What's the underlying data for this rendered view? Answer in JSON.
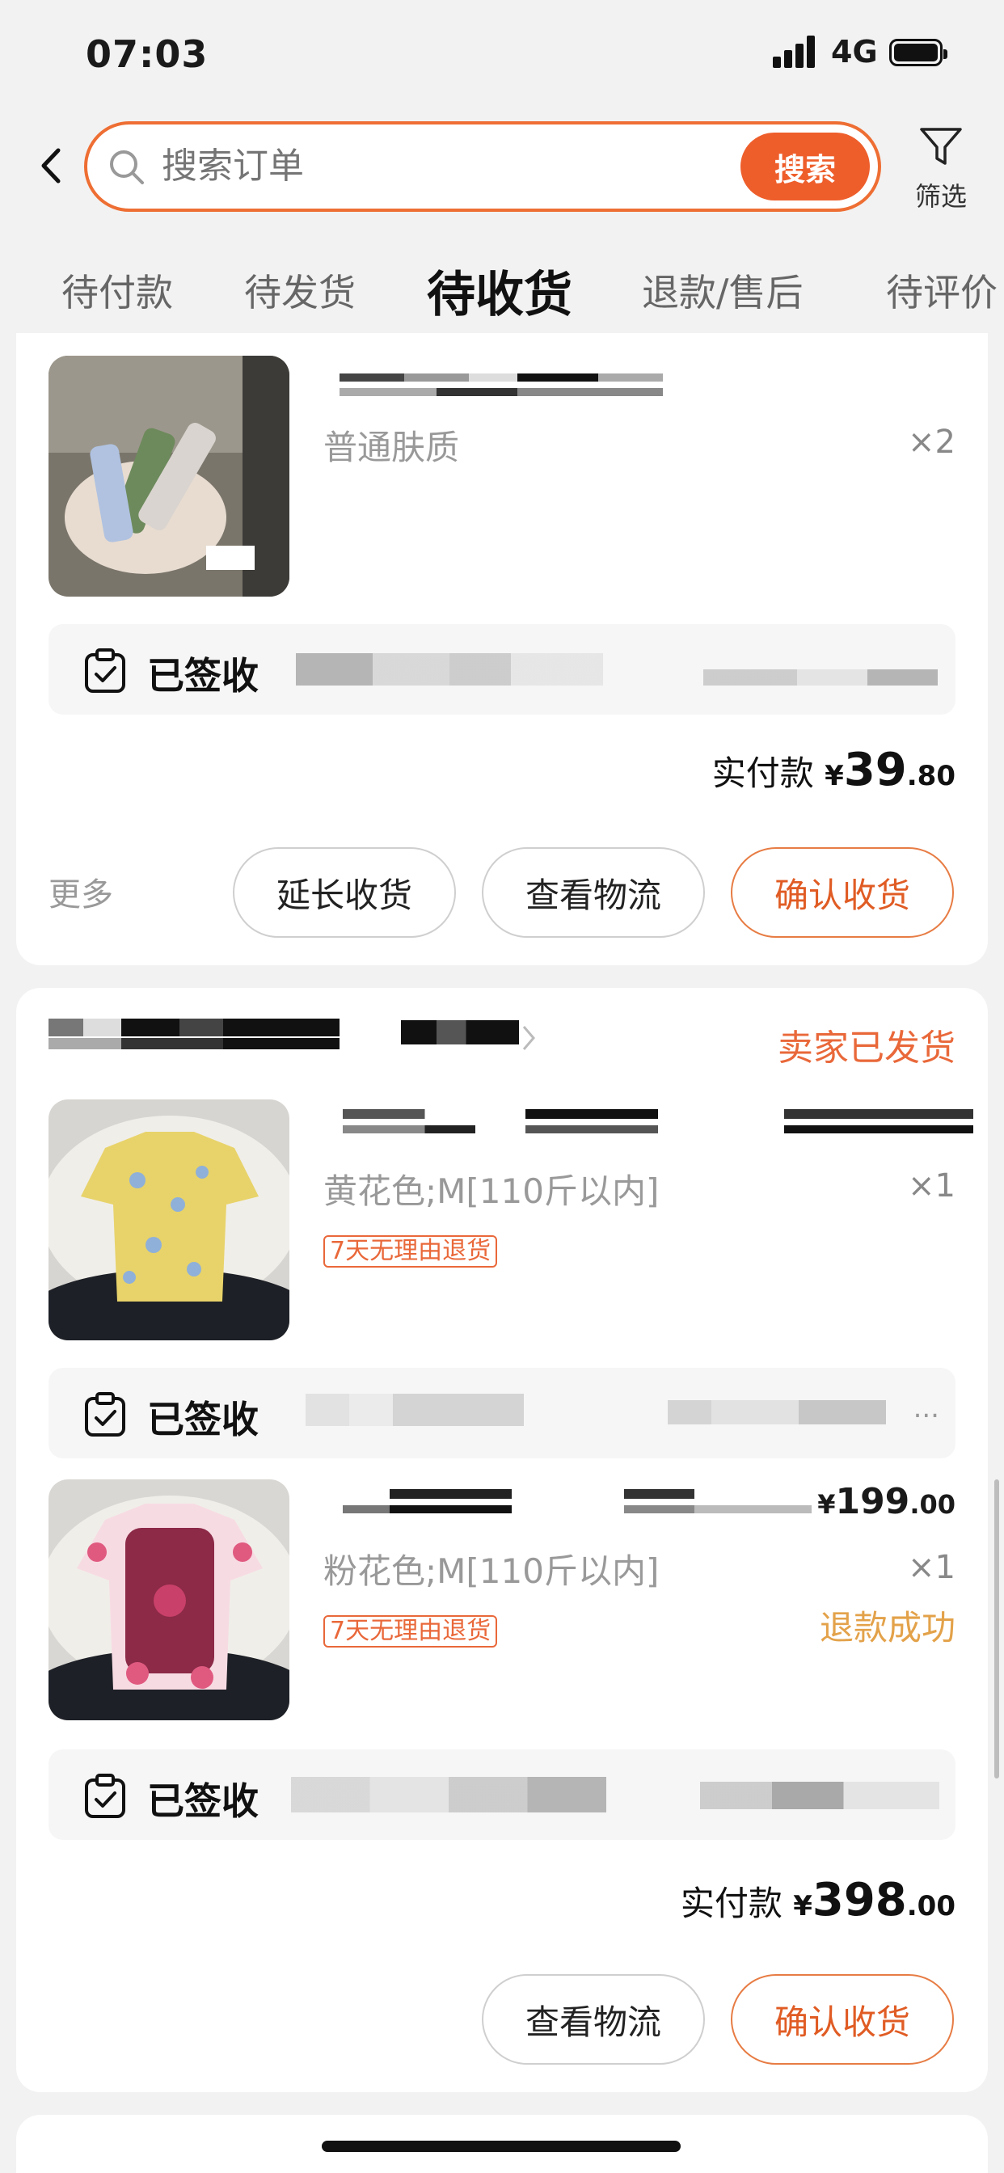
{
  "status": {
    "time": "07:03",
    "network": "4G"
  },
  "search": {
    "placeholder": "搜索订单",
    "button": "搜索",
    "filter_label": "筛选"
  },
  "tabs": [
    {
      "label": "待付款",
      "active": false
    },
    {
      "label": "待发货",
      "active": false
    },
    {
      "label": "待收货",
      "active": true
    },
    {
      "label": "退款/售后",
      "active": false
    },
    {
      "label": "待评价",
      "active": false
    }
  ],
  "order1": {
    "item": {
      "variant": "普通肤质",
      "qty": "×2"
    },
    "signed_label": "已签收",
    "paid_label": "实付款",
    "currency": "¥",
    "amount_int": "39",
    "amount_dec": ".80",
    "more": "更多",
    "buttons": {
      "extend": "延长收货",
      "logistics": "查看物流",
      "confirm": "确认收货"
    }
  },
  "order2": {
    "status": "卖家已发货",
    "items": [
      {
        "variant": "黄花色;M[110斤以内]",
        "qty": "×1",
        "tag": "7天无理由退货"
      },
      {
        "variant": "粉花色;M[110斤以内]",
        "qty": "×1",
        "tag": "7天无理由退货",
        "price_currency": "¥",
        "price_int": "199",
        "price_dec": ".00",
        "refund": "退款成功"
      }
    ],
    "signed_label": "已签收",
    "ellipsis": "...",
    "paid_label": "实付款",
    "currency": "¥",
    "amount_int": "398",
    "amount_dec": ".00",
    "buttons": {
      "logistics": "查看物流",
      "confirm": "确认收货"
    }
  },
  "colors": {
    "accent": "#ee5e2b",
    "accent_text": "#e05c24",
    "refund": "#e3a24a",
    "background": "#f2f2f2"
  }
}
